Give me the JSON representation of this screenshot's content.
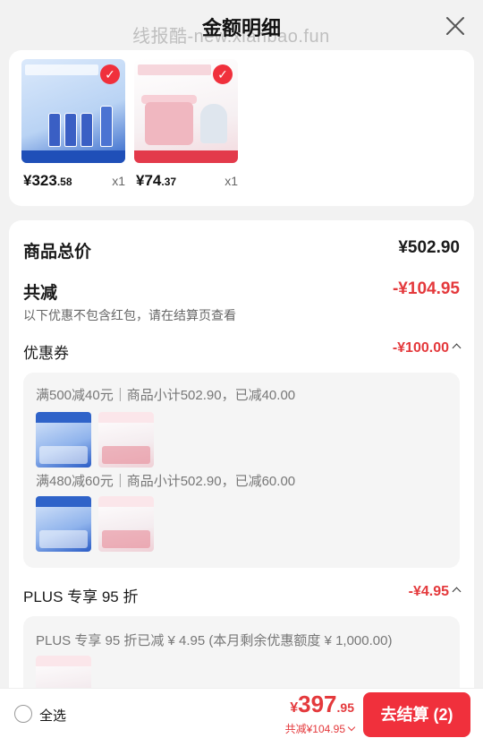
{
  "header": {
    "title": "金额明细",
    "watermark": "线报酷-new.xianbao.fun"
  },
  "products": [
    {
      "price_int": "¥323",
      "price_dec": ".58",
      "qty": "x1"
    },
    {
      "price_int": "¥74",
      "price_dec": ".37",
      "qty": "x1"
    }
  ],
  "summary": {
    "total_label": "商品总价",
    "total_value": "¥502.90",
    "reduce_label": "共减",
    "reduce_value": "-¥104.95",
    "note": "以下优惠不包含红包，请在结算页查看"
  },
  "coupon": {
    "label": "优惠券",
    "value": "-¥100.00",
    "rules": [
      "满500减40元｜商品小计502.90，已减40.00",
      "满480减60元｜商品小计502.90，已减60.00"
    ]
  },
  "plus": {
    "label": "PLUS 专享 95 折",
    "value": "-¥4.95",
    "detail": "PLUS 专享 95 折已减 ¥ 4.95 (本月剩余优惠额度 ¥ 1,000.00)"
  },
  "bottom": {
    "select_all": "全选",
    "amount_cur": "¥",
    "amount_int": "397",
    "amount_dec": ".95",
    "saved": "共减¥104.95",
    "checkout": "去结算 (2)"
  },
  "colors": {
    "accent": "#f0303c",
    "price_red": "#e4393c"
  }
}
